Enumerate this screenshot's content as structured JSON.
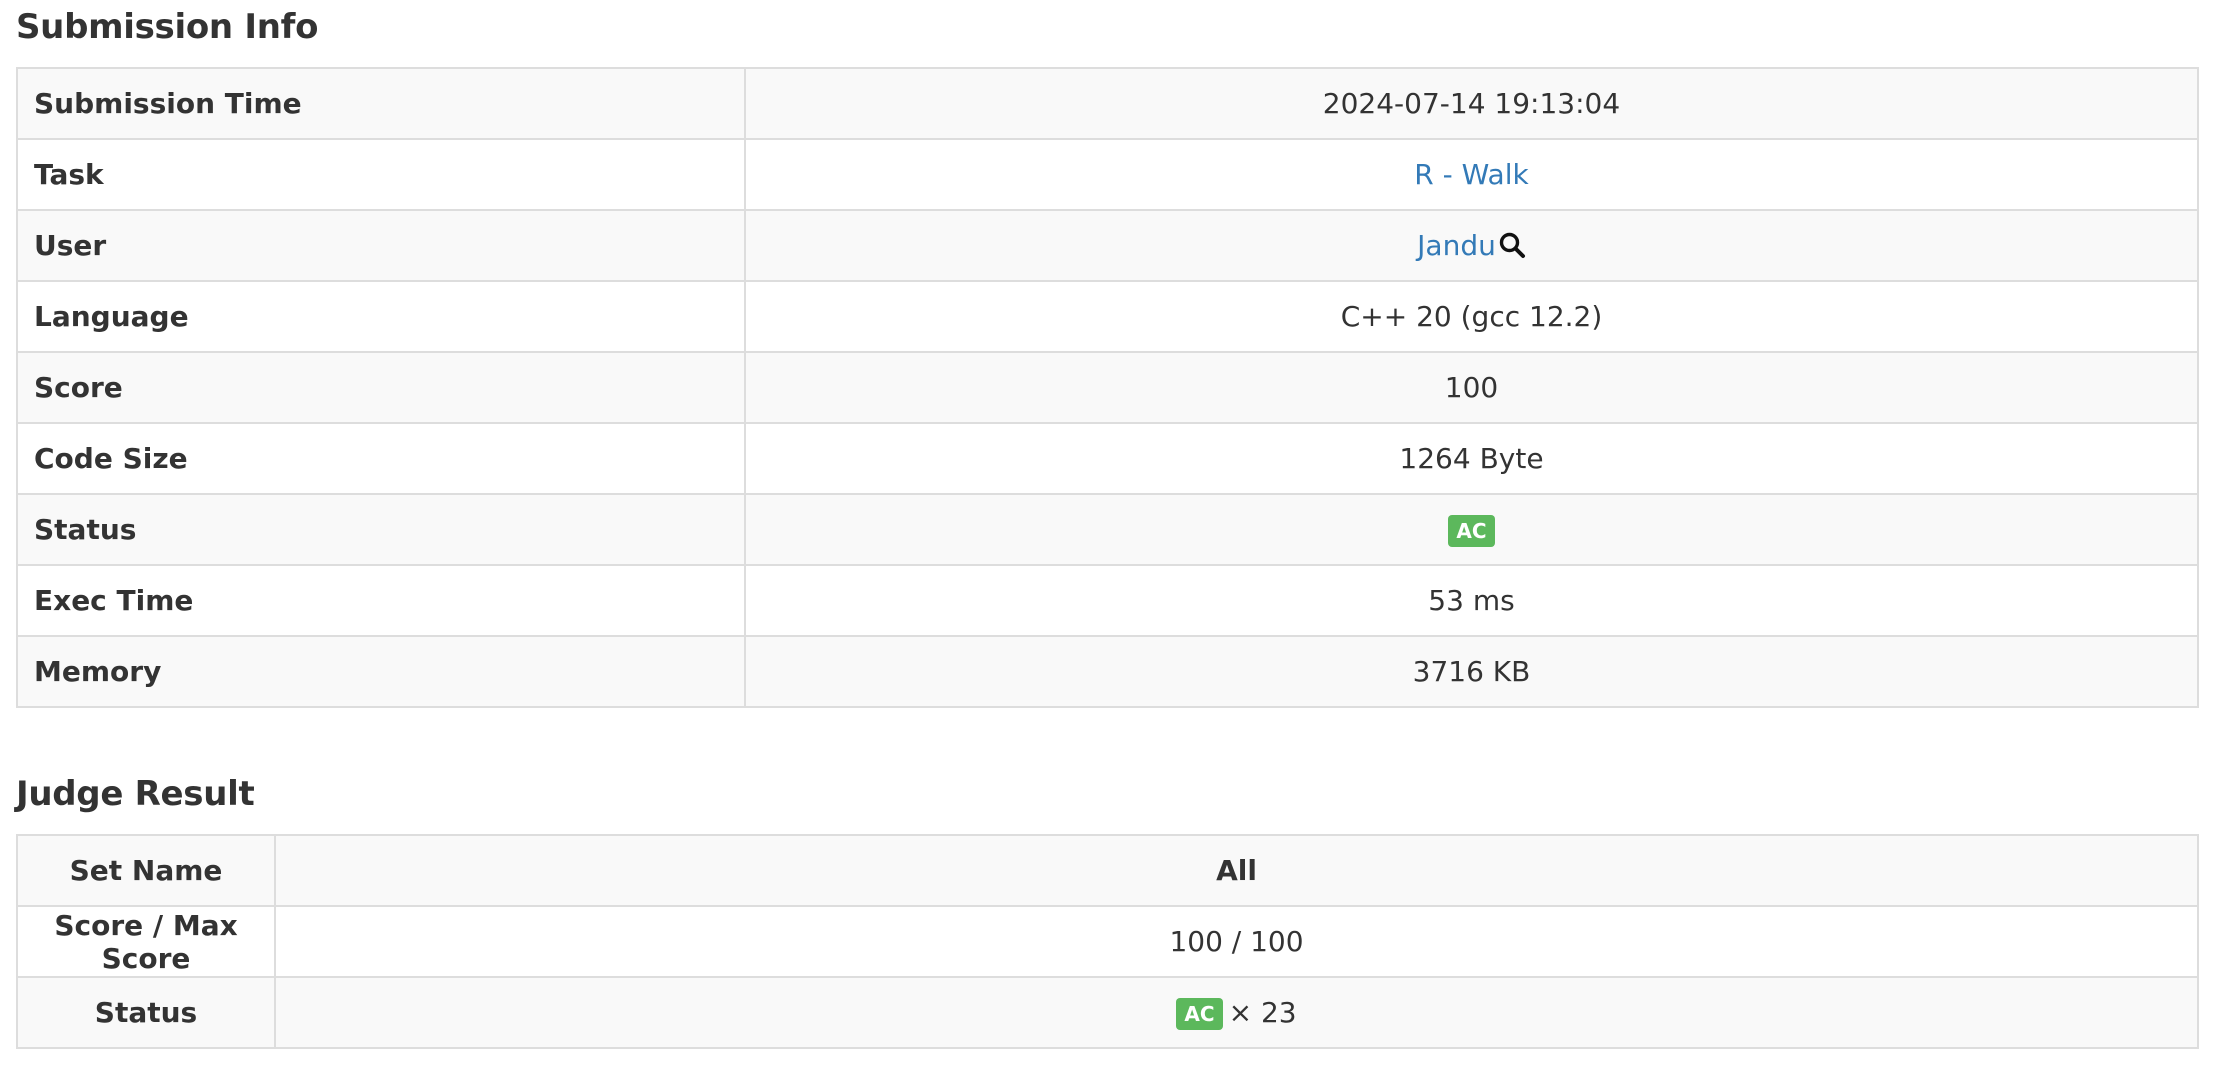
{
  "submission_info": {
    "title": "Submission Info",
    "rows": {
      "submission_time": {
        "label": "Submission Time",
        "value": "2024-07-14 19:13:04"
      },
      "task": {
        "label": "Task",
        "value": "R - Walk"
      },
      "user": {
        "label": "User",
        "value": "Jandu",
        "icon": "search-icon"
      },
      "language": {
        "label": "Language",
        "value": "C++ 20 (gcc 12.2)"
      },
      "score": {
        "label": "Score",
        "value": "100"
      },
      "code_size": {
        "label": "Code Size",
        "value": "1264 Byte"
      },
      "status": {
        "label": "Status",
        "value": "AC",
        "color": "#5cb85c"
      },
      "exec_time": {
        "label": "Exec Time",
        "value": "53 ms"
      },
      "memory": {
        "label": "Memory",
        "value": "3716 KB"
      }
    }
  },
  "judge_result": {
    "title": "Judge Result",
    "set_name": {
      "label": "Set Name",
      "value": "All"
    },
    "score": {
      "label": "Score / Max Score",
      "value": "100 / 100"
    },
    "status": {
      "label": "Status",
      "badge": "AC",
      "count": "× 23",
      "color": "#5cb85c"
    }
  },
  "colors": {
    "link": "#337ab7",
    "badge_green": "#5cb85c",
    "row_stripe": "#f9f9f9",
    "border": "#dddddd"
  }
}
